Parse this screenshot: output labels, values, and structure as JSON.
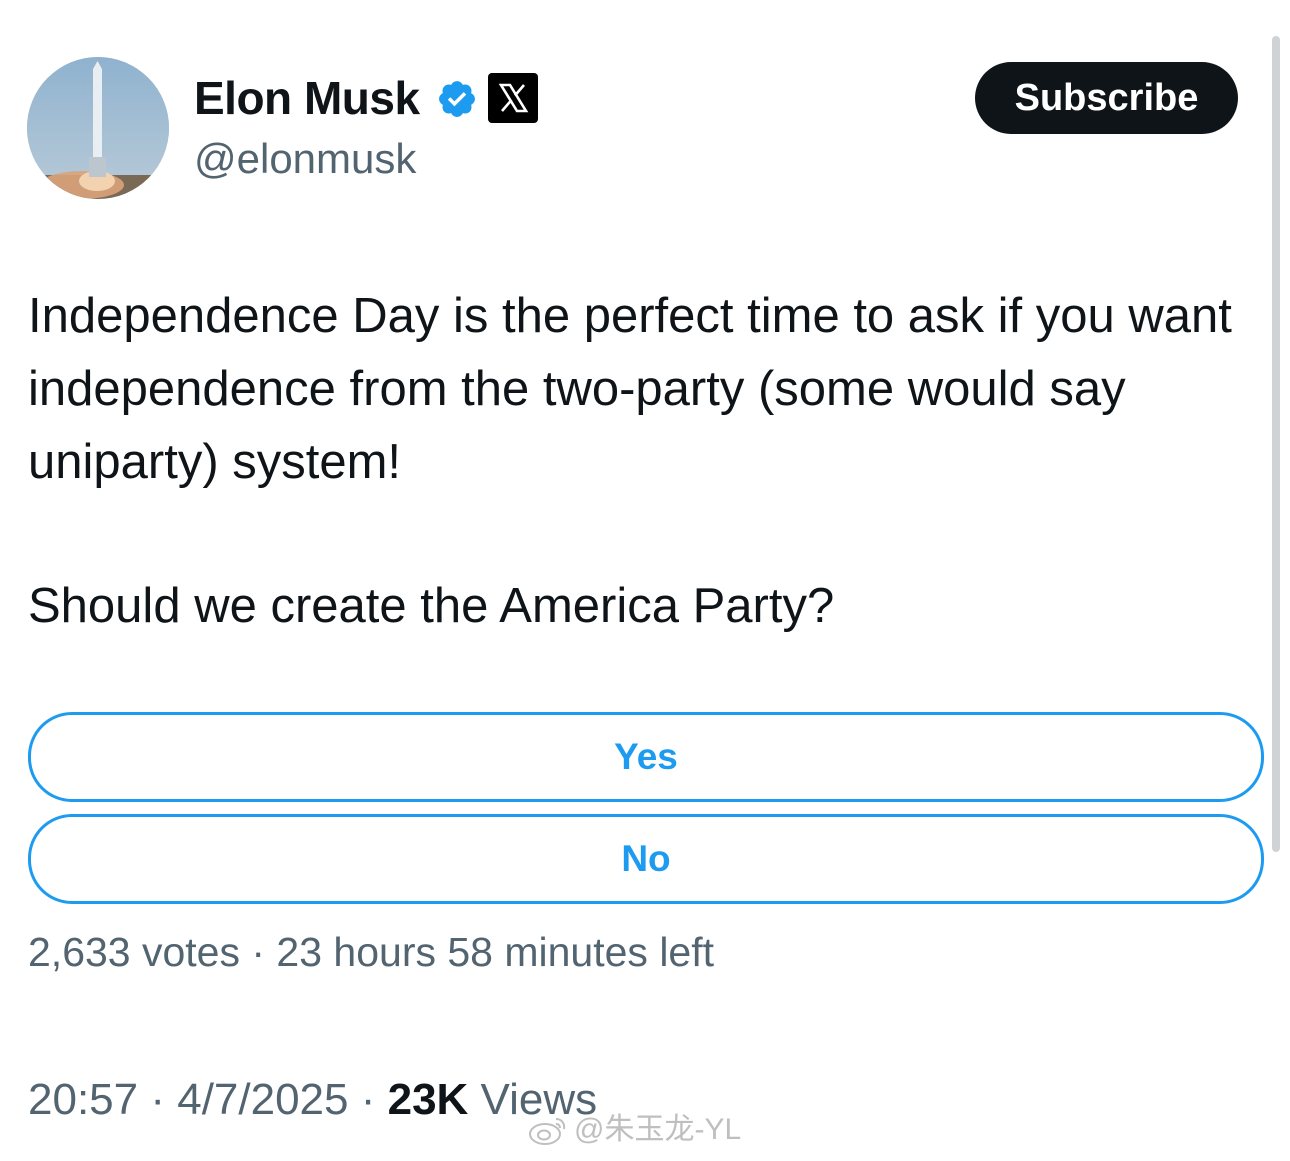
{
  "author": {
    "display_name": "Elon Musk",
    "handle": "@elonmusk",
    "verified": true,
    "affiliation_badge": "x-logo-icon"
  },
  "actions": {
    "subscribe_label": "Subscribe"
  },
  "tweet": {
    "text": "Independence Day is the perfect time to ask if you want independence from the two-party (some would say uniparty) system!",
    "question": "Should we create the America Party?"
  },
  "poll": {
    "options": [
      {
        "label": "Yes"
      },
      {
        "label": "No"
      }
    ],
    "meta": "2,633 votes · 23 hours 58 minutes left"
  },
  "footer": {
    "time": "20:57",
    "separator": " · ",
    "date": "4/7/2025",
    "views_count": "23K",
    "views_label": " Views"
  },
  "watermark": {
    "text": "@朱玉龙-YL"
  },
  "colors": {
    "accent": "#1d9bf0",
    "secondary_text": "#536471",
    "primary_text": "#0f1419"
  }
}
